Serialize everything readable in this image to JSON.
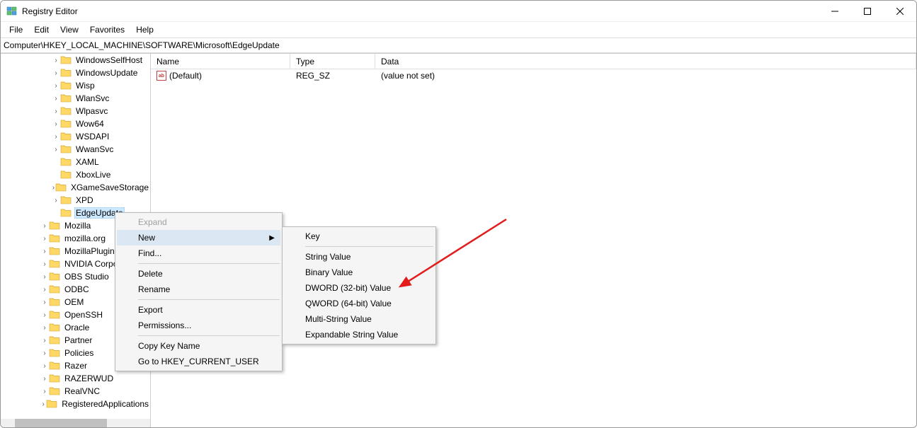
{
  "window": {
    "title": "Registry Editor"
  },
  "menu": {
    "file": "File",
    "edit": "Edit",
    "view": "View",
    "favorites": "Favorites",
    "help": "Help"
  },
  "address": "Computer\\HKEY_LOCAL_MACHINE\\SOFTWARE\\Microsoft\\EdgeUpdate",
  "columns": {
    "name": "Name",
    "type": "Type",
    "data": "Data"
  },
  "values": [
    {
      "name": "(Default)",
      "type": "REG_SZ",
      "data": "(value not set)"
    }
  ],
  "tree": [
    {
      "label": "WindowsSelfHost",
      "expandable": true,
      "indent": 4
    },
    {
      "label": "WindowsUpdate",
      "expandable": true,
      "indent": 4
    },
    {
      "label": "Wisp",
      "expandable": true,
      "indent": 4
    },
    {
      "label": "WlanSvc",
      "expandable": true,
      "indent": 4
    },
    {
      "label": "Wlpasvc",
      "expandable": true,
      "indent": 4
    },
    {
      "label": "Wow64",
      "expandable": true,
      "indent": 4
    },
    {
      "label": "WSDAPI",
      "expandable": true,
      "indent": 4
    },
    {
      "label": "WwanSvc",
      "expandable": true,
      "indent": 4
    },
    {
      "label": "XAML",
      "expandable": false,
      "indent": 4
    },
    {
      "label": "XboxLive",
      "expandable": false,
      "indent": 4
    },
    {
      "label": "XGameSaveStorage",
      "expandable": true,
      "indent": 4
    },
    {
      "label": "XPD",
      "expandable": true,
      "indent": 4
    },
    {
      "label": "EdgeUpdate",
      "expandable": false,
      "indent": 4,
      "selected": true
    },
    {
      "label": "Mozilla",
      "expandable": true,
      "indent": 3
    },
    {
      "label": "mozilla.org",
      "expandable": true,
      "indent": 3
    },
    {
      "label": "MozillaPlugins",
      "expandable": true,
      "indent": 3
    },
    {
      "label": "NVIDIA Corporation",
      "expandable": true,
      "indent": 3
    },
    {
      "label": "OBS Studio",
      "expandable": true,
      "indent": 3
    },
    {
      "label": "ODBC",
      "expandable": true,
      "indent": 3
    },
    {
      "label": "OEM",
      "expandable": true,
      "indent": 3
    },
    {
      "label": "OpenSSH",
      "expandable": true,
      "indent": 3
    },
    {
      "label": "Oracle",
      "expandable": true,
      "indent": 3
    },
    {
      "label": "Partner",
      "expandable": true,
      "indent": 3
    },
    {
      "label": "Policies",
      "expandable": true,
      "indent": 3
    },
    {
      "label": "Razer",
      "expandable": true,
      "indent": 3
    },
    {
      "label": "RAZERWUD",
      "expandable": true,
      "indent": 3
    },
    {
      "label": "RealVNC",
      "expandable": true,
      "indent": 3
    },
    {
      "label": "RegisteredApplications",
      "expandable": true,
      "indent": 3
    }
  ],
  "context_menu_1": [
    {
      "label": "Expand",
      "type": "item",
      "disabled": true
    },
    {
      "label": "New",
      "type": "item",
      "submenu": true,
      "highlight": true
    },
    {
      "label": "Find...",
      "type": "item"
    },
    {
      "type": "sep"
    },
    {
      "label": "Delete",
      "type": "item"
    },
    {
      "label": "Rename",
      "type": "item"
    },
    {
      "type": "sep"
    },
    {
      "label": "Export",
      "type": "item"
    },
    {
      "label": "Permissions...",
      "type": "item"
    },
    {
      "type": "sep"
    },
    {
      "label": "Copy Key Name",
      "type": "item"
    },
    {
      "label": "Go to HKEY_CURRENT_USER",
      "type": "item"
    }
  ],
  "context_menu_2": [
    {
      "label": "Key",
      "type": "item"
    },
    {
      "type": "sep"
    },
    {
      "label": "String Value",
      "type": "item"
    },
    {
      "label": "Binary Value",
      "type": "item"
    },
    {
      "label": "DWORD (32-bit) Value",
      "type": "item"
    },
    {
      "label": "QWORD (64-bit) Value",
      "type": "item"
    },
    {
      "label": "Multi-String Value",
      "type": "item"
    },
    {
      "label": "Expandable String Value",
      "type": "item"
    }
  ]
}
